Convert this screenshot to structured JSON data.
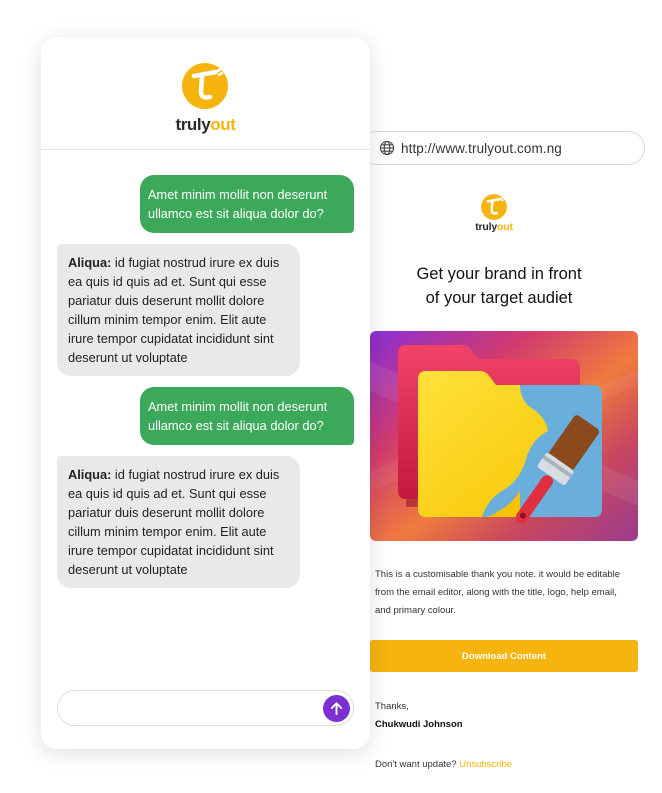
{
  "colors": {
    "brand_yellow": "#f5b40e",
    "brand_dark": "#2a2a2a",
    "outgoing_bubble": "#3ba85a",
    "incoming_bubble": "#e9e9e9",
    "send_button": "#7b2fd0"
  },
  "chat": {
    "brand": {
      "part1": "truly",
      "part2": "out"
    },
    "messages": [
      {
        "direction": "out",
        "text": "Amet minim mollit non deserunt ullamco est sit aliqua dolor do?"
      },
      {
        "direction": "in",
        "sender": "Aliqua:",
        "text": " id fugiat nostrud irure ex duis ea quis id quis ad et. Sunt qui esse pariatur duis deserunt mollit dolore cillum minim tempor enim. Elit aute irure tempor cupidatat incididunt sint deserunt ut voluptate"
      },
      {
        "direction": "out",
        "text": "Amet minim mollit non deserunt ullamco est sit aliqua dolor do?"
      },
      {
        "direction": "in",
        "sender": "Aliqua:",
        "text": " id fugiat nostrud irure ex duis ea quis id quis ad et. Sunt qui esse pariatur duis deserunt mollit dolore cillum minim tempor enim. Elit aute irure tempor cupidatat incididunt sint deserunt ut voluptate"
      }
    ],
    "composer": {
      "value": "",
      "send_icon": "arrow-up-icon"
    }
  },
  "email": {
    "url": "http://www.trulyout.com.ng",
    "url_icon": "globe-icon",
    "brand": {
      "part1": "truly",
      "part2": "out"
    },
    "headline_line1": "Get your brand in front",
    "headline_line2": "of your target audiet",
    "hero_image": "folder-with-paintbrush",
    "body": "This is a customisable thank you note. it would be editable from the email editor, along with the title, logo, help email, and  primary colour.",
    "button_label": "Download Content",
    "thanks": "Thanks,",
    "signature": "Chukwudi Johnson",
    "footer_text": "Don't want update? ",
    "unsubscribe": "Unsubscribe"
  }
}
